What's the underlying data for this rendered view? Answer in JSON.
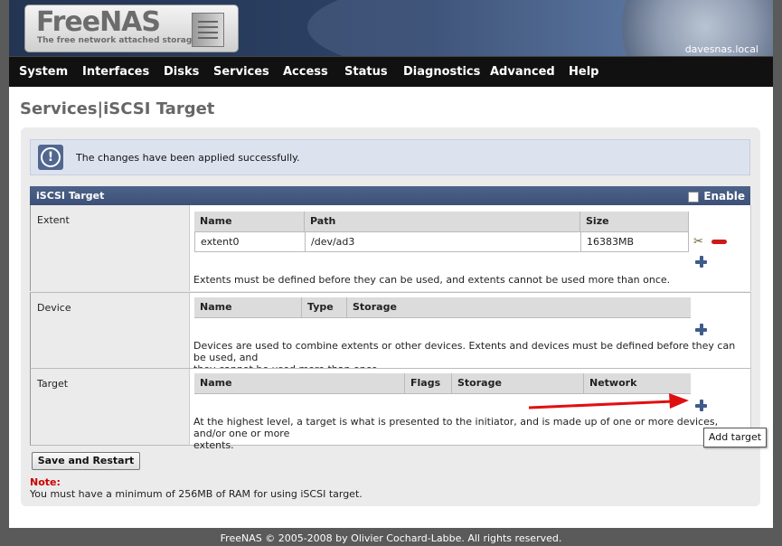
{
  "header": {
    "brand": "FreeNAS",
    "tagline": "The free network attached storage",
    "hostname": "davesnas.local"
  },
  "nav": {
    "items": [
      "System",
      "Interfaces",
      "Disks",
      "Services",
      "Access",
      "Status",
      "Diagnostics",
      "Advanced",
      "Help"
    ]
  },
  "page": {
    "title": "Services|iSCSI Target"
  },
  "message": {
    "icon": "info-icon",
    "text": "The changes have been applied successfully."
  },
  "section": {
    "title": "iSCSI Target",
    "enable_label": "Enable"
  },
  "extent": {
    "label": "Extent",
    "columns": [
      "Name",
      "Path",
      "Size"
    ],
    "rows": [
      {
        "name": "extent0",
        "path": "/dev/ad3",
        "size": "16383MB"
      }
    ],
    "description": "Extents must be defined before they can be used, and extents cannot be used more than once."
  },
  "device": {
    "label": "Device",
    "columns": [
      "Name",
      "Type",
      "Storage"
    ],
    "description_line1": "Devices are used to combine extents or other devices. Extents and devices must be defined before they can be used, and",
    "description_line2": "they cannot be used more than once."
  },
  "target": {
    "label": "Target",
    "columns": [
      "Name",
      "Flags",
      "Storage",
      "Network"
    ],
    "description_line1": "At the highest level, a target is what is presented to the initiator, and is made up of one or more devices, and/or one or more",
    "description_line2": "extents.",
    "tooltip": "Add target"
  },
  "actions": {
    "save_restart": "Save and Restart"
  },
  "note": {
    "label": "Note:",
    "text": "You must have a minimum of 256MB of RAM for using iSCSI target."
  },
  "footer": {
    "text": "FreeNAS © 2005-2008 by Olivier Cochard-Labbe. All rights reserved."
  },
  "colors": {
    "nav_bg": "#111111",
    "section_bar": "#4d6289",
    "note_label": "#cc0000",
    "arrow": "#e01010",
    "add_icon": "#3f5b88"
  }
}
